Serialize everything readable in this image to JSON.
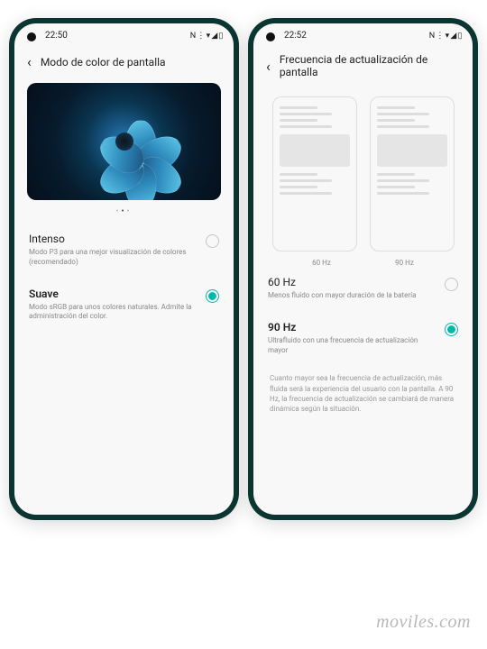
{
  "watermark": "moviles.com",
  "left": {
    "time": "22:50",
    "status_icons": "N ⋮ ▾ ◢ ▯",
    "title": "Modo de color de pantalla",
    "dots": "•••",
    "options": [
      {
        "title": "Intenso",
        "desc": "Modo P3 para una mejor visualización de colores (recomendado)",
        "selected": false
      },
      {
        "title": "Suave",
        "desc": "Modo sRGB para unos colores naturales. Admite la administración del color.",
        "selected": true
      }
    ]
  },
  "right": {
    "time": "22:52",
    "status_icons": "N ⋮ ▾ ◢ ▯",
    "title": "Frecuencia de actualización de pantalla",
    "preview_labels": [
      "60 Hz",
      "90 Hz"
    ],
    "options": [
      {
        "title": "60 Hz",
        "desc": "Menos fluido con mayor duración de la batería",
        "selected": false
      },
      {
        "title": "90 Hz",
        "desc": "Ultrafluido con una frecuencia de actualización mayor",
        "selected": true
      }
    ],
    "footer": "Cuanto mayor sea la frecuencia de actualización, más fluida será la experiencia del usuario con la pantalla. A 90 Hz, la frecuencia de actualización se cambiará de manera dinámica según la situación."
  }
}
